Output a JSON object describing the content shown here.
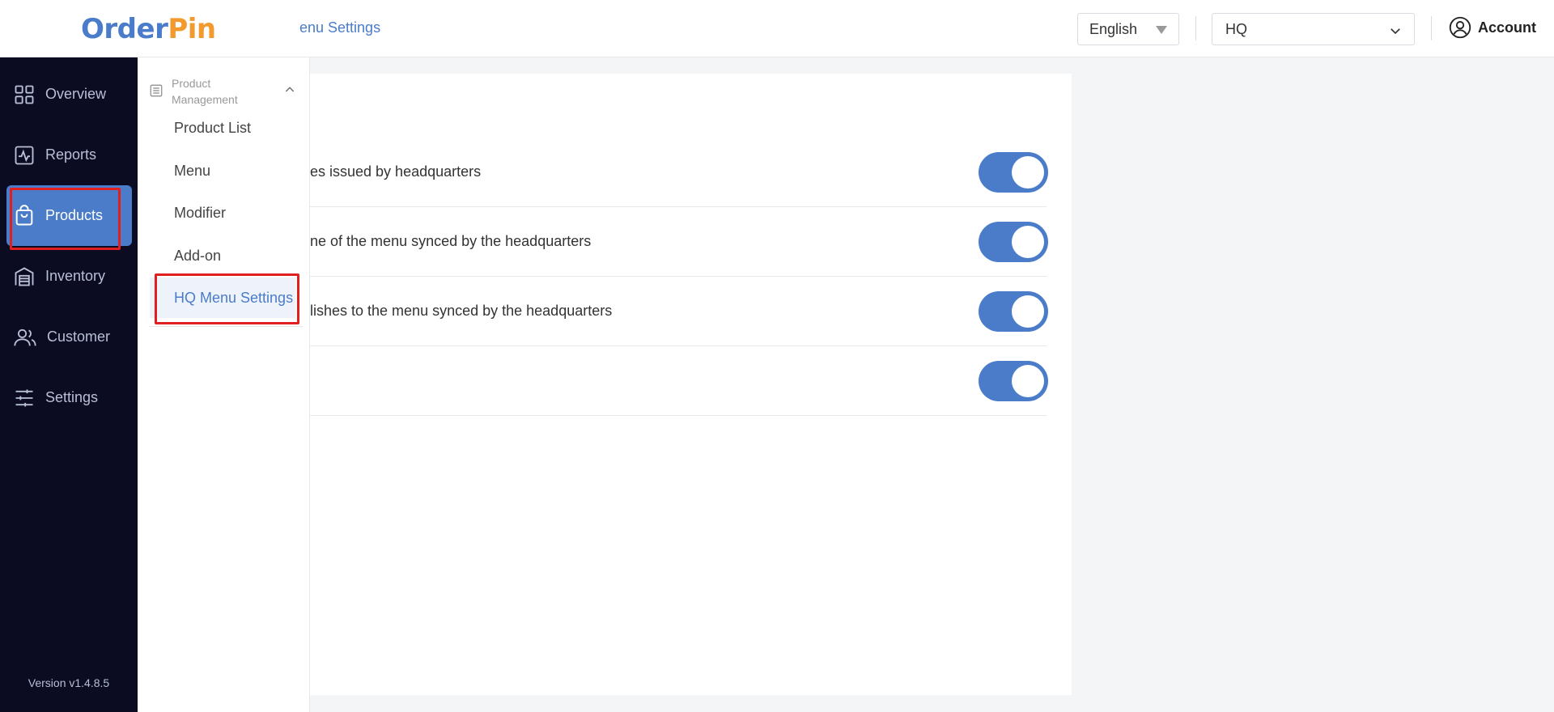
{
  "app": {
    "logo_part1": "Order",
    "logo_part2": "Pin",
    "breadcrumb": "enu Settings"
  },
  "header": {
    "language": "English",
    "store": "HQ",
    "account_label": "Account"
  },
  "sidebar": {
    "items": [
      {
        "label": "Overview",
        "icon": "grid-icon"
      },
      {
        "label": "Reports",
        "icon": "activity-icon"
      },
      {
        "label": "Products",
        "icon": "shopping-bag-icon",
        "active": true
      },
      {
        "label": "Inventory",
        "icon": "warehouse-icon"
      },
      {
        "label": "Customer",
        "icon": "users-icon"
      },
      {
        "label": "Settings",
        "icon": "sliders-icon"
      }
    ],
    "version": "Version v1.4.8.5"
  },
  "submenu": {
    "group_label_line1": "Product",
    "group_label_line2": "Management",
    "items": [
      {
        "label": "Product List"
      },
      {
        "label": "Menu"
      },
      {
        "label": "Modifier"
      },
      {
        "label": "Add-on"
      },
      {
        "label": "HQ Menu Settings",
        "active": true
      }
    ]
  },
  "settings": [
    {
      "label": "es issued by headquarters",
      "enabled": true
    },
    {
      "label": "ne of the menu synced by the headquarters",
      "enabled": true
    },
    {
      "label": "lishes to the menu synced by the headquarters",
      "enabled": true
    },
    {
      "label": "",
      "enabled": true
    }
  ],
  "colors": {
    "accent": "#4a7cc9",
    "logo_orange": "#f29a2e",
    "sidebar_bg": "#0b0b22",
    "highlight": "#e02020"
  }
}
